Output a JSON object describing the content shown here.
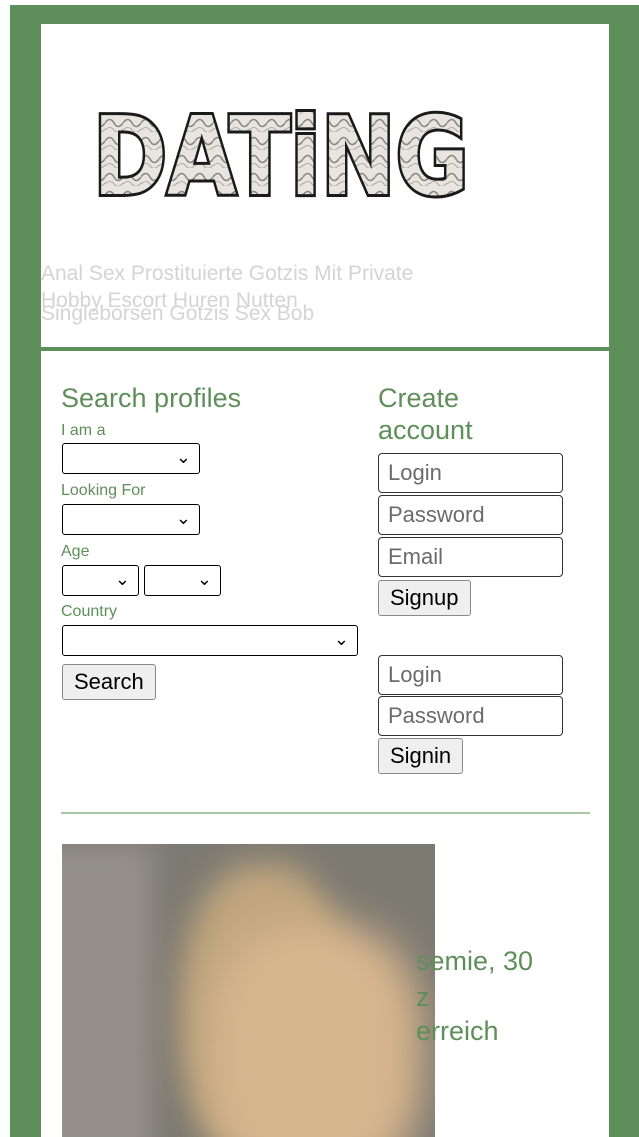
{
  "header": {
    "logo_text": "DATiNG",
    "ghost_line1": "Anal Sex Prostituierte Gotzis Mit Private",
    "ghost_line2a": "Hobby Escort Huren Nutten",
    "ghost_line2b": "Singleborsen Gotzis Sex Bob"
  },
  "search": {
    "title": "Search profiles",
    "i_am_label": "I am a",
    "looking_for_label": "Looking For",
    "age_label": "Age",
    "country_label": "Country",
    "search_button": "Search",
    "select_icon": "chevron-down-icon"
  },
  "account": {
    "title_line1": "Create",
    "title_line2": "account",
    "signup_login_placeholder": "Login",
    "signup_password_placeholder": "Password",
    "signup_email_placeholder": "Email",
    "signup_button": "Signup",
    "signin_login_placeholder": "Login",
    "signin_password_placeholder": "Password",
    "signin_button": "Signin"
  },
  "profile": {
    "line1": "semie, 30",
    "line2": "z",
    "line3": "erreich"
  },
  "colors": {
    "accent": "#5e8f5a"
  }
}
